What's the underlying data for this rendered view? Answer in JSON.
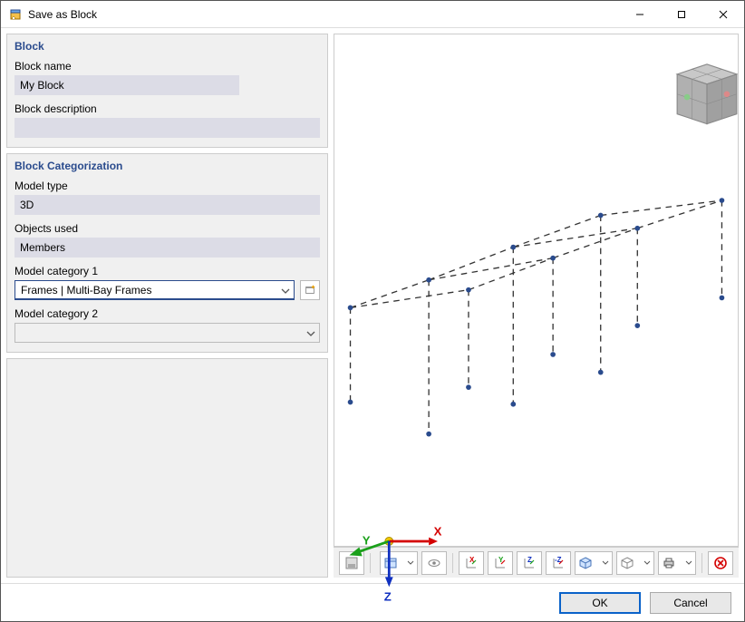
{
  "window": {
    "title": "Save as Block",
    "minimize_tooltip": "Minimize",
    "maximize_tooltip": "Maximize",
    "close_tooltip": "Close"
  },
  "block_panel": {
    "title": "Block",
    "name_label": "Block name",
    "name_value": "My Block",
    "description_label": "Block description",
    "description_value": ""
  },
  "categorization_panel": {
    "title": "Block Categorization",
    "model_type_label": "Model type",
    "model_type_value": "3D",
    "objects_used_label": "Objects used",
    "objects_used_value": "Members",
    "category1_label": "Model category 1",
    "category1_value": "Frames | Multi-Bay Frames",
    "category2_label": "Model category 2",
    "category2_value": ""
  },
  "axis_labels": {
    "x": "X",
    "y": "Y",
    "z": "Z"
  },
  "footer": {
    "ok": "OK",
    "cancel": "Cancel"
  }
}
